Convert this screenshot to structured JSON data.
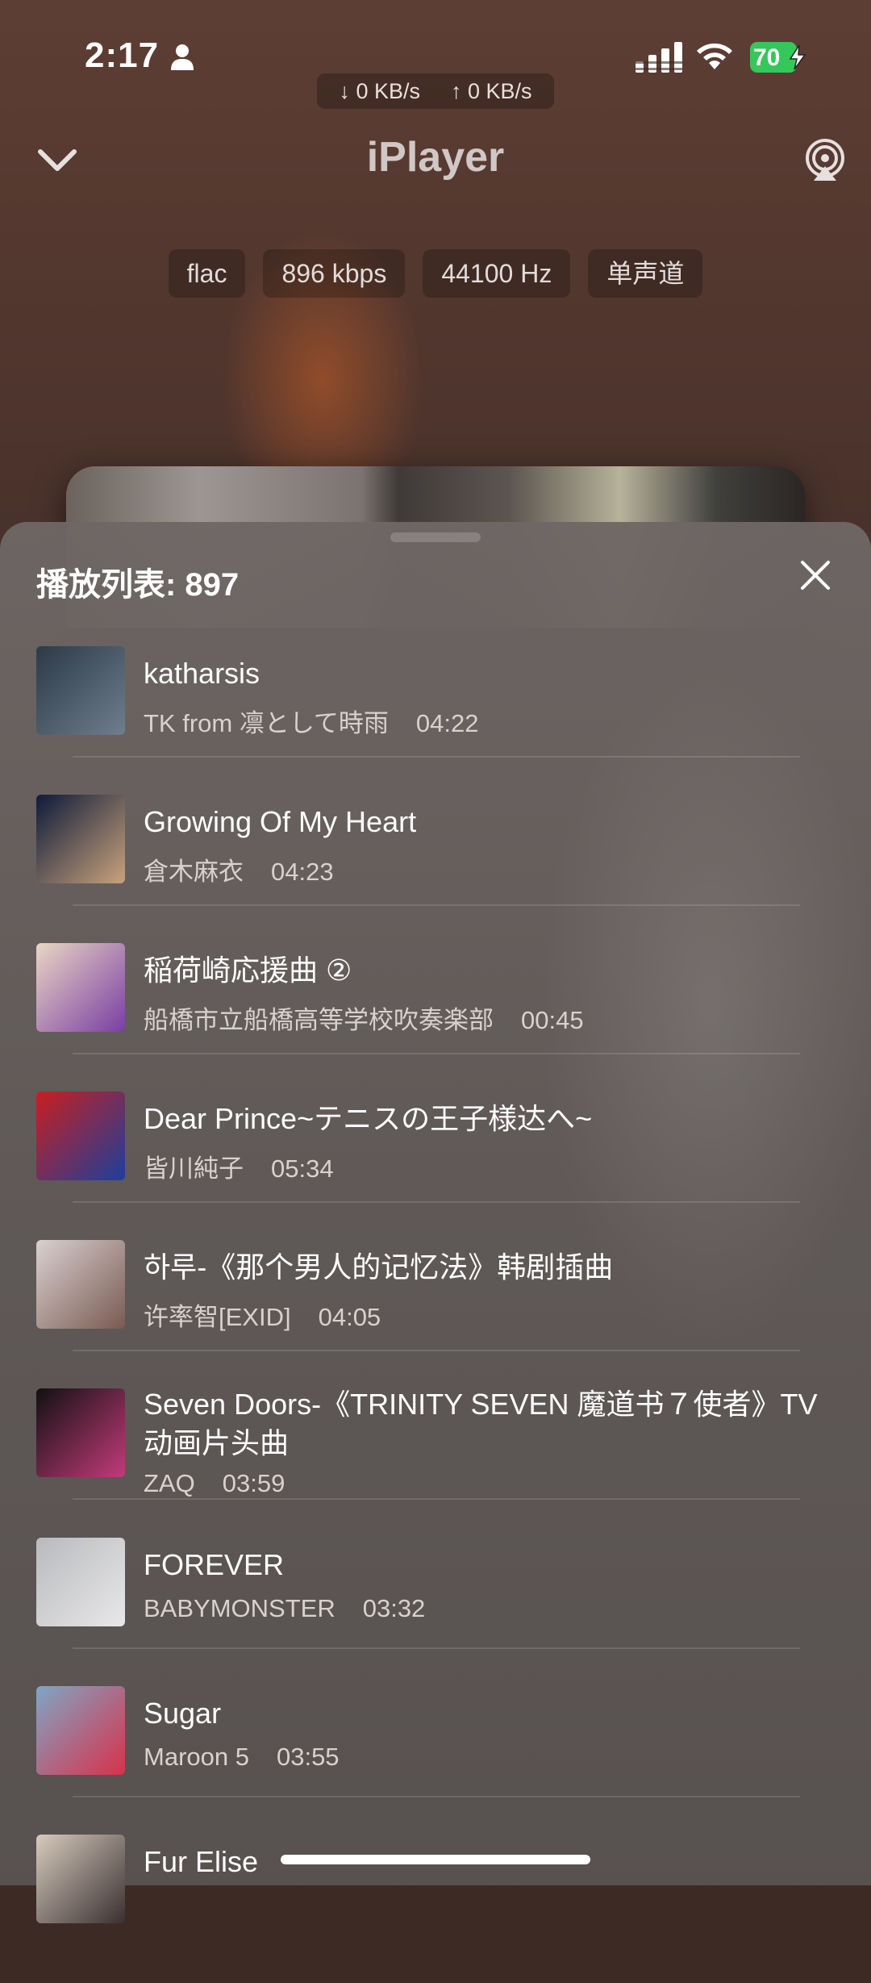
{
  "status_bar": {
    "time": "2:17",
    "battery": "70",
    "download_speed": "↓ 0 KB/s",
    "upload_speed": "↑ 0 KB/s"
  },
  "header": {
    "title": "iPlayer"
  },
  "format_chips": [
    "flac",
    "896 kbps",
    "44100 Hz",
    "单声道"
  ],
  "playlist": {
    "title": "播放列表: 897",
    "songs": [
      {
        "title": "katharsis",
        "artist": "TK from 凛として時雨",
        "duration": "04:22",
        "thumb_colors": [
          "#2c3a48",
          "#6f7e8c"
        ]
      },
      {
        "title": "Growing Of My Heart",
        "artist": "倉木麻衣",
        "duration": "04:23",
        "thumb_colors": [
          "#0d1b3a",
          "#c9a27c"
        ]
      },
      {
        "title": "稲荷崎応援曲 ②",
        "artist": "船橋市立船橋高等学校吹奏楽部",
        "duration": "00:45",
        "thumb_colors": [
          "#e9d6c4",
          "#7a3ea3"
        ]
      },
      {
        "title": "Dear Prince~テニスの王子様达へ~",
        "artist": "皆川純子",
        "duration": "05:34",
        "thumb_colors": [
          "#c71f1f",
          "#1d3f9a"
        ]
      },
      {
        "title": "하루-《那个男人的记忆法》韩剧插曲",
        "artist": "许率智[EXID]",
        "duration": "04:05",
        "thumb_colors": [
          "#d9d1d0",
          "#7a5a52"
        ]
      },
      {
        "title": "Seven Doors-《TRINITY SEVEN 魔道书７使者》TV动画片头曲",
        "artist": "ZAQ",
        "duration": "03:59",
        "thumb_colors": [
          "#111111",
          "#c23b7a"
        ]
      },
      {
        "title": "FOREVER",
        "artist": "BABYMONSTER",
        "duration": "03:32",
        "thumb_colors": [
          "#b9babd",
          "#e8e8ea"
        ]
      },
      {
        "title": "Sugar",
        "artist": "Maroon 5",
        "duration": "03:55",
        "thumb_colors": [
          "#7fa6c6",
          "#d8314a"
        ]
      },
      {
        "title": "Fur Elise",
        "artist": "",
        "duration": "",
        "thumb_colors": [
          "#d7cbbd",
          "#3a3030"
        ]
      }
    ]
  }
}
